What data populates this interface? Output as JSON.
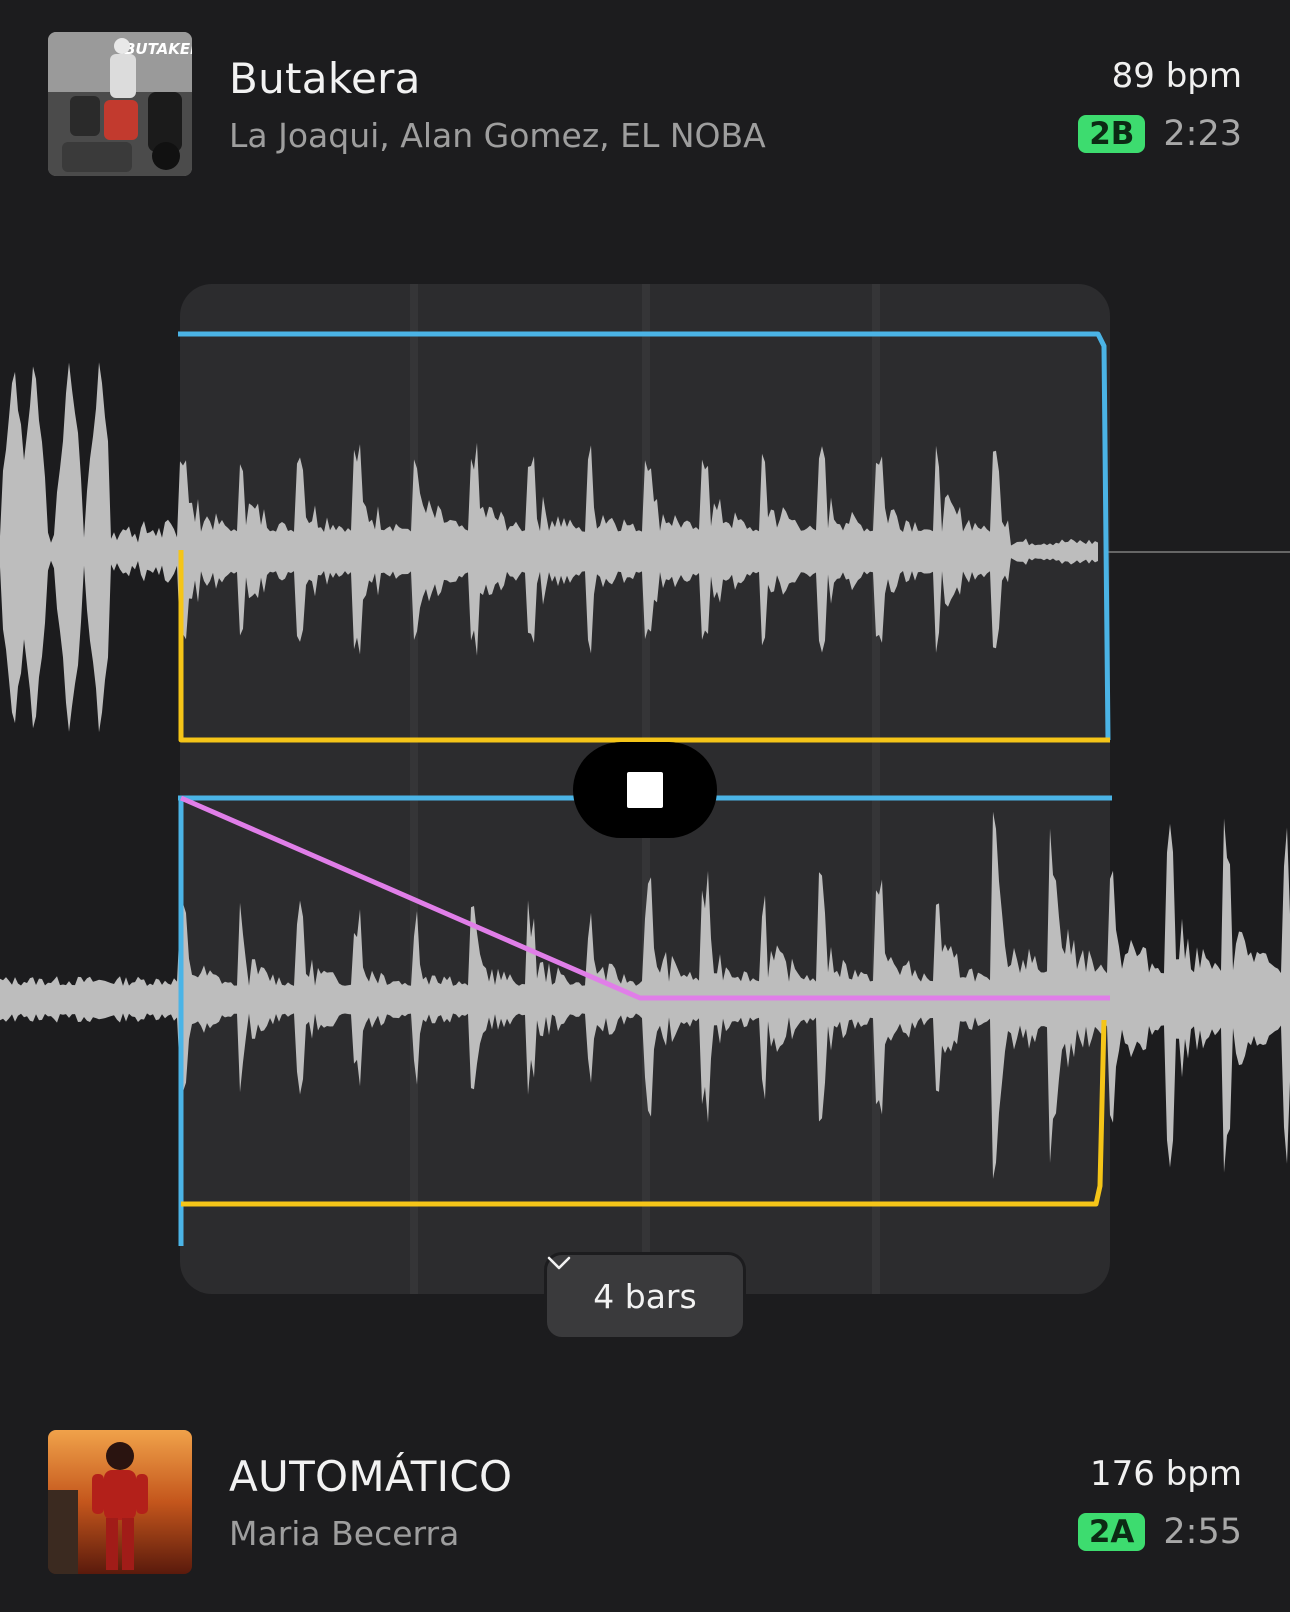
{
  "track_top": {
    "title": "Butakera",
    "artists": "La Joaqui, Alan Gomez, EL NOBA",
    "bpm": "89 bpm",
    "key": "2B",
    "duration": "2:23",
    "cover_text": "BUTAKERA"
  },
  "track_bottom": {
    "title": "AUTOMÁTICO",
    "artists": "Maria Becerra",
    "bpm": "176 bpm",
    "key": "2A",
    "duration": "2:55"
  },
  "transition": {
    "length_label": "4 bars",
    "colors": {
      "tempo_line": "#4bb4e6",
      "volume_line": "#f5c518",
      "eq_line": "#e07ee8",
      "waveform": "#bdbdbd",
      "key_badge": "#3ddc6f"
    }
  }
}
